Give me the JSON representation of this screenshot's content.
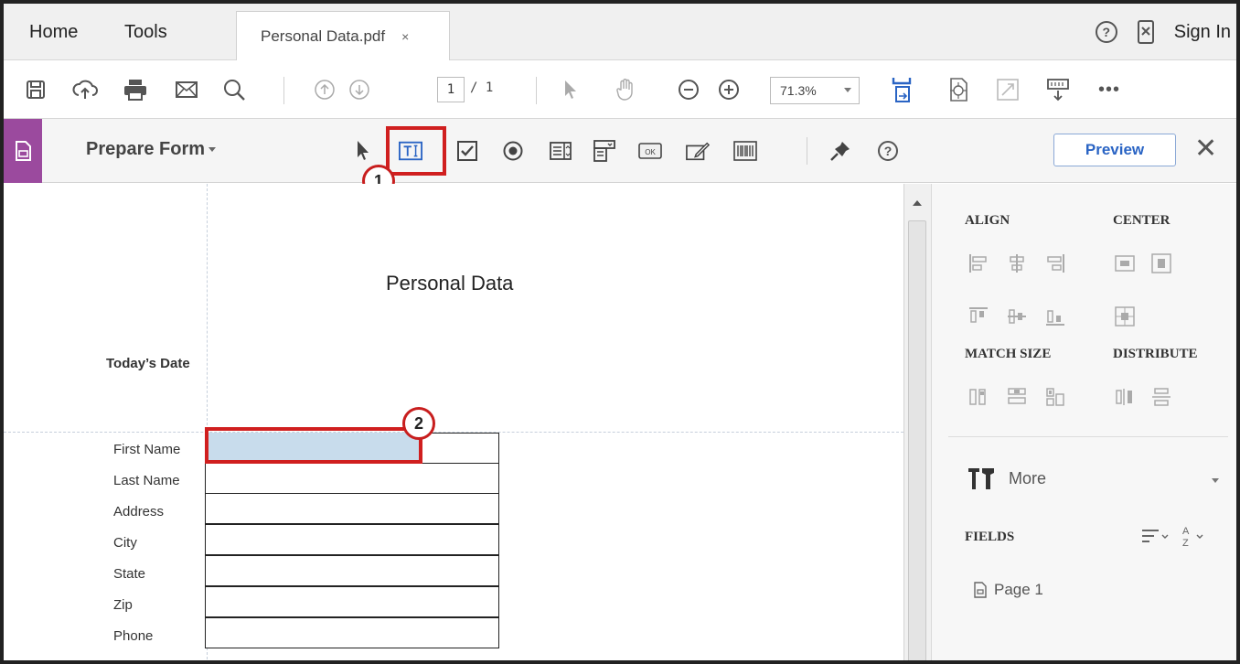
{
  "tabs": {
    "home": "Home",
    "tools": "Tools",
    "document": "Personal Data.pdf",
    "close_glyph": "×"
  },
  "header_right": {
    "help_glyph": "?",
    "sign_in": "Sign In"
  },
  "toolbar": {
    "page_current": "1",
    "page_total": "/ 1",
    "zoom": "71.3%",
    "icons": [
      "save-icon",
      "upload-icon",
      "print-icon",
      "email-icon",
      "search-icon",
      "prev-page-icon",
      "next-page-icon",
      "select-cursor-icon",
      "hand-icon",
      "zoom-out-icon",
      "zoom-in-icon",
      "fit-page-icon",
      "rotate-icon",
      "fullscreen-icon",
      "scroll-mode-icon",
      "more-icon"
    ]
  },
  "form_bar": {
    "tool_name": "Prepare Form",
    "preview": "Preview",
    "close_glyph": "✕",
    "help_glyph": "?",
    "icons": [
      "select-icon",
      "text-field-icon",
      "checkbox-icon",
      "radio-button-icon",
      "list-box-icon",
      "dropdown-icon",
      "button-icon",
      "signature-icon",
      "barcode-icon",
      "pin-icon",
      "help-icon"
    ]
  },
  "callouts": {
    "one": "1",
    "two": "2"
  },
  "colors": {
    "accent_purple": "#9b4a9e",
    "callout_red": "#d01f1f",
    "selected_field": "#c8dcec",
    "link_blue": "#2a64c4"
  },
  "document": {
    "title": "Personal Data",
    "date_label": "Today’s Date",
    "fields": [
      "First Name",
      "Last Name",
      "Address",
      "City",
      "State",
      "Zip",
      "Phone"
    ]
  },
  "panel": {
    "align": "ALIGN",
    "center": "CENTER",
    "match_size": "MATCH SIZE",
    "distribute": "DISTRIBUTE",
    "more": "More",
    "fields": "FIELDS",
    "page_item": "Page 1"
  }
}
